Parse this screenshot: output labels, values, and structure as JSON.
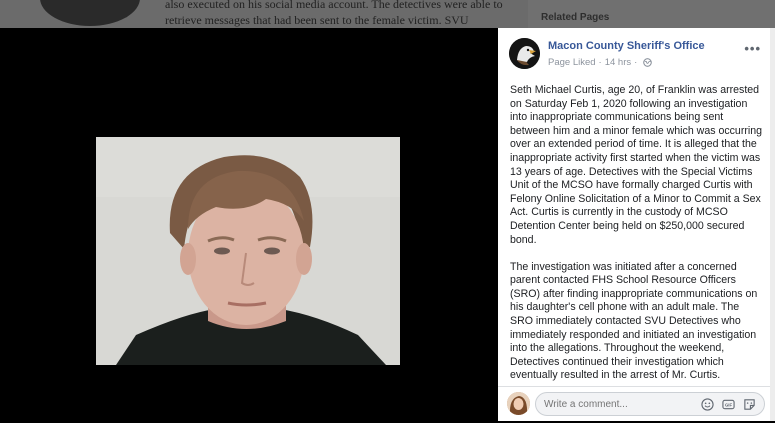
{
  "background_page": {
    "article_text": "also executed on his social media account. The detectives were able to retrieve messages that had been sent to the female victim. SVU",
    "related_heading": "Related Pages"
  },
  "post": {
    "page_name": "Macon County Sheriff's Office",
    "liked_status": "Page Liked",
    "time": "14 hrs",
    "paragraphs": [
      "Seth Michael Curtis, age 20, of Franklin was arrested on Saturday Feb 1, 2020 following an investigation into inappropriate communications being sent between him and a minor female which was occurring over an extended period of time. It is alleged that the inappropriate activity first started when the victim was 13 years of age. Detectives with the Special Victims Unit of the MCSO have formally charged Curtis with Felony Online Solicitation of a Minor to Commit a Sex Act. Curtis is currently in the custody of MCSO Detention Center being held on $250,000 secured bond.",
      "The investigation was initiated after a concerned parent contacted FHS School Resource Officers (SRO) after finding inappropriate communications on his daughter's cell phone with an adult male. The SRO immediately contacted SVU Detectives who immediately responded and initiated an investigation into the allegations. Throughout the weekend, Detectives continued their investigation which eventually resulted in the arrest of Mr. Curtis."
    ]
  },
  "comment": {
    "placeholder": "Write a comment..."
  },
  "icons": {
    "globe": "globe-icon",
    "more": "more-options-icon",
    "emoji": "emoji-icon",
    "gif": "gif-icon",
    "sticker": "sticker-icon"
  },
  "colors": {
    "link": "#385898",
    "lightbox": "#000000",
    "meta": "#8d949e"
  }
}
